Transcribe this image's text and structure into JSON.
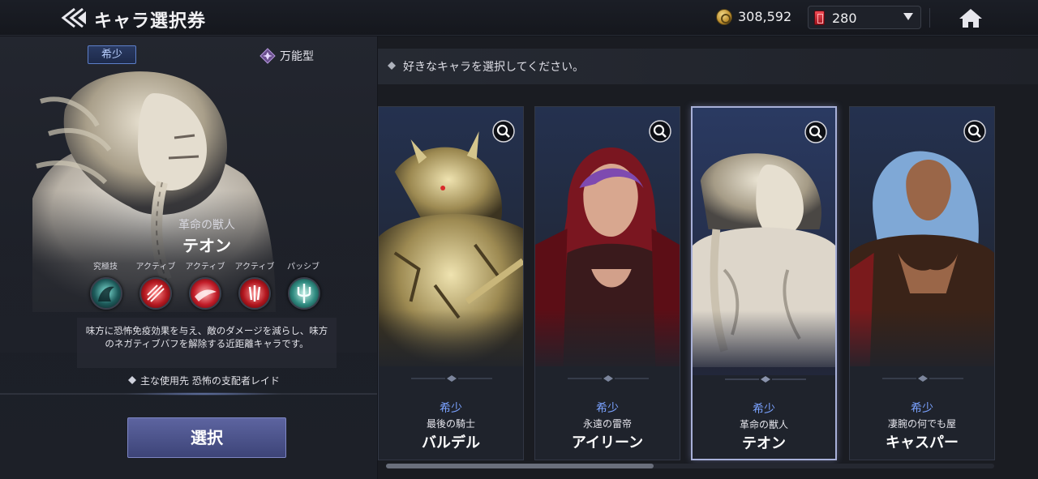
{
  "header": {
    "title": "キャラ選択券",
    "gold": "308,592",
    "gems": "280"
  },
  "selected": {
    "rarity": "希少",
    "role": "万能型",
    "epithet": "革命の獣人",
    "name": "テオン",
    "skill_types": [
      "究極技",
      "アクティブ",
      "アクティブ",
      "アクティブ",
      "パッシブ"
    ],
    "description": "味方に恐怖免疫効果を与え、敵のダメージを減らし、味方のネガティブバフを解除する近距離キャラです。",
    "usage": "主な使用先 恐怖の支配者レイド",
    "select_label": "選択"
  },
  "list": {
    "instruction": "好きなキャラを選択してください。",
    "cards": [
      {
        "rarity": "希少",
        "epithet": "最後の騎士",
        "name": "バルデル",
        "selected": false
      },
      {
        "rarity": "希少",
        "epithet": "永遠の雷帝",
        "name": "アイリーン",
        "selected": false
      },
      {
        "rarity": "希少",
        "epithet": "革命の獣人",
        "name": "テオン",
        "selected": true
      },
      {
        "rarity": "希少",
        "epithet": "凄腕の何でも屋",
        "name": "キャスパー",
        "selected": false
      }
    ],
    "scroll_fraction": 0.44
  },
  "colors": {
    "rarity_blue": "#7aa2ff",
    "select_button": "#4a5190",
    "gem_red": "#d2303a",
    "gold": "#c89a38"
  }
}
